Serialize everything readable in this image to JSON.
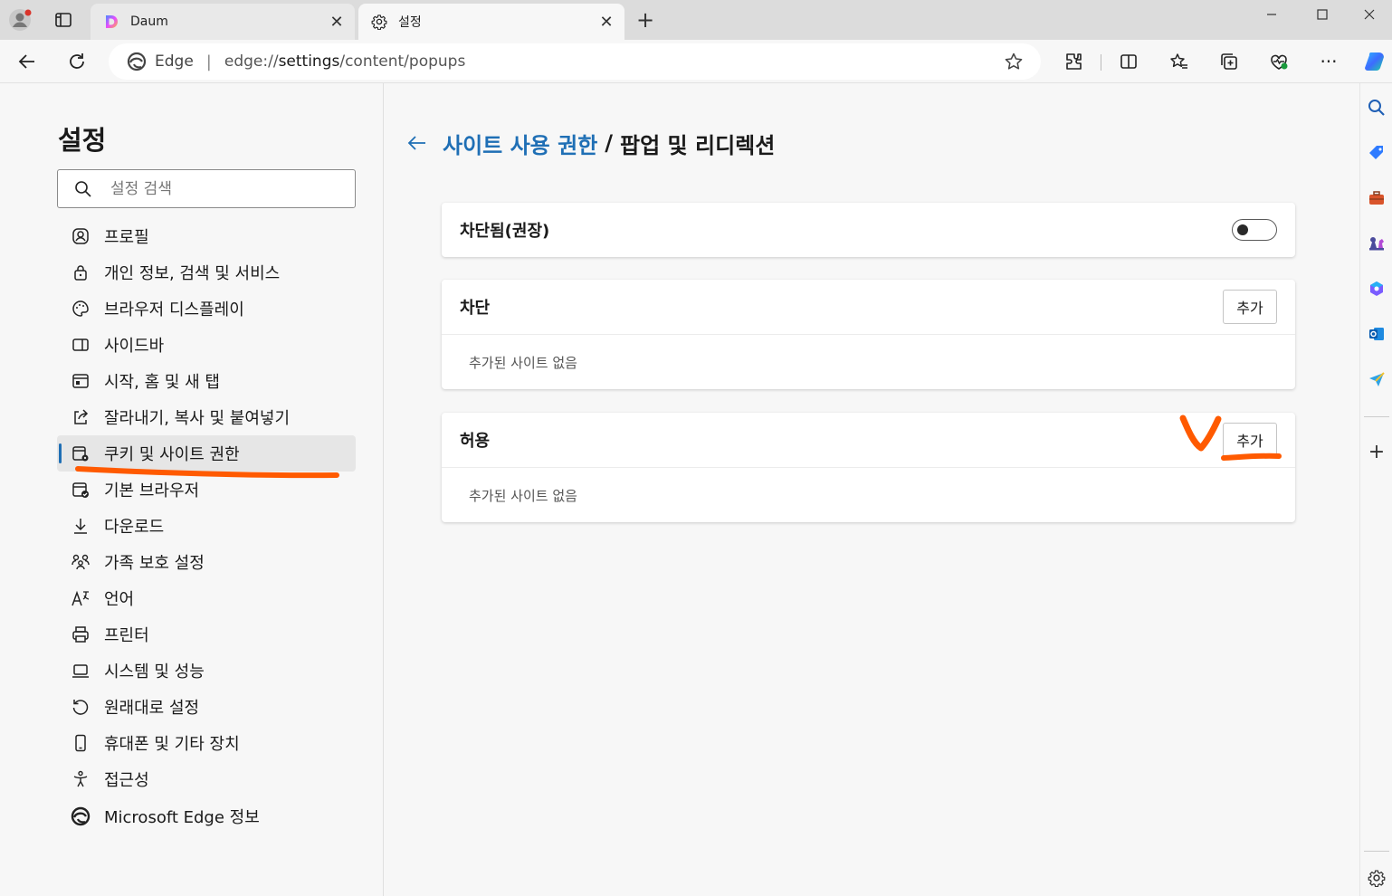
{
  "browser": {
    "tabs": [
      {
        "title": "Daum",
        "active": false
      },
      {
        "title": "설정",
        "active": true
      }
    ],
    "omnibox": {
      "edge_label": "Edge",
      "separator": "|",
      "url_prefix": "edge://",
      "url_host": "settings",
      "url_path": "/content/popups"
    }
  },
  "nav": {
    "title": "설정",
    "search_placeholder": "설정 검색",
    "items": [
      {
        "label": "프로필",
        "icon": "profile-icon"
      },
      {
        "label": "개인 정보, 검색 및 서비스",
        "icon": "lock-icon"
      },
      {
        "label": "브라우저 디스플레이",
        "icon": "palette-icon"
      },
      {
        "label": "사이드바",
        "icon": "sidebar-icon"
      },
      {
        "label": "시작, 홈 및 새 탭",
        "icon": "home-tabs-icon"
      },
      {
        "label": "잘라내기, 복사 및 붙여넣기",
        "icon": "share-icon"
      },
      {
        "label": "쿠키 및 사이트 권한",
        "icon": "cookie-settings-icon",
        "selected": true
      },
      {
        "label": "기본 브라우저",
        "icon": "default-browser-icon"
      },
      {
        "label": "다운로드",
        "icon": "download-icon"
      },
      {
        "label": "가족 보호 설정",
        "icon": "family-icon"
      },
      {
        "label": "언어",
        "icon": "language-icon"
      },
      {
        "label": "프린터",
        "icon": "printer-icon"
      },
      {
        "label": "시스템 및 성능",
        "icon": "laptop-icon"
      },
      {
        "label": "원래대로 설정",
        "icon": "reset-icon"
      },
      {
        "label": "휴대폰 및 기타 장치",
        "icon": "phone-icon"
      },
      {
        "label": "접근성",
        "icon": "accessibility-icon"
      },
      {
        "label": "Microsoft Edge 정보",
        "icon": "edge-logo-icon"
      }
    ]
  },
  "main": {
    "breadcrumb": {
      "parent": "사이트 사용 권한",
      "separator": "/",
      "current": "팝업 및 리디렉션"
    },
    "blocked_recommended": {
      "label": "차단됨(권장)",
      "toggle_on": false
    },
    "block_section": {
      "title": "차단",
      "add_label": "추가",
      "empty_text": "추가된 사이트 없음"
    },
    "allow_section": {
      "title": "허용",
      "add_label": "추가",
      "empty_text": "추가된 사이트 없음"
    }
  },
  "colors": {
    "accent": "#1f6fb5",
    "annotation": "#ff5a00"
  }
}
